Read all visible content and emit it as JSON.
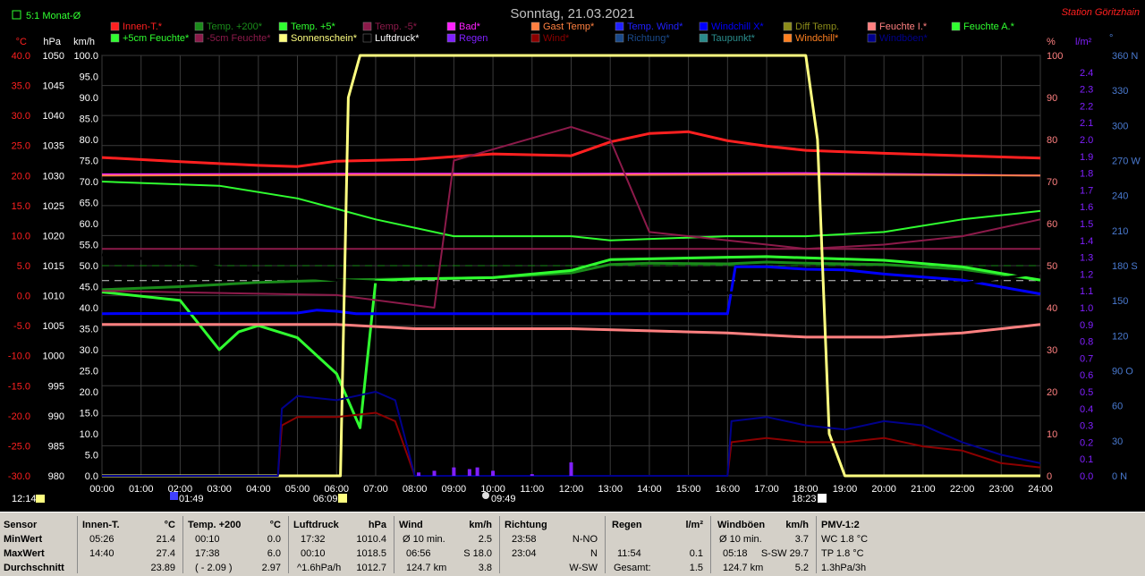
{
  "header": {
    "title": "Sonntag, 21.03.2021",
    "station": "Station Göritzhain",
    "period_label": "5:1 Monat-Ø"
  },
  "legend": [
    {
      "label": "Innen-T.*",
      "color": "#ff2020"
    },
    {
      "label": "Temp. +200*",
      "color": "#1a8c1a"
    },
    {
      "label": "Temp. +5*",
      "color": "#30ff30"
    },
    {
      "label": "Temp. -5*",
      "color": "#8c1a4a"
    },
    {
      "label": "Bad*",
      "color": "#ff20ff"
    },
    {
      "label": "Gast Temp*",
      "color": "#ff8040"
    },
    {
      "label": "Temp. Wind*",
      "color": "#2020ff"
    },
    {
      "label": "Windchill X*",
      "color": "#0000ff"
    },
    {
      "label": "Diff Temp.",
      "color": "#8c8c1a"
    },
    {
      "label": "Feuchte I.*",
      "color": "#ff8080"
    },
    {
      "label": "Feuchte A.*",
      "color": "#30ff30"
    },
    {
      "label": "+5cm Feuchte*",
      "color": "#30ff30"
    },
    {
      "label": "-5cm Feuchte*",
      "color": "#8c1a4a"
    },
    {
      "label": "Sonnenschein*",
      "color": "#ffff80"
    },
    {
      "label": "Luftdruck*",
      "color": "#000000"
    },
    {
      "label": "Regen",
      "color": "#8020ff"
    },
    {
      "label": "Wind*",
      "color": "#8c0000"
    },
    {
      "label": "Richtung*",
      "color": "#1a4a8c"
    },
    {
      "label": "Taupunkt*",
      "color": "#2a8c8c"
    },
    {
      "label": "Windchill*",
      "color": "#ff8020"
    },
    {
      "label": "Windböen*",
      "color": "#00008c"
    }
  ],
  "axes": {
    "celsius": {
      "unit": "°C",
      "ticks": [
        "40.0",
        "35.0",
        "30.0",
        "25.0",
        "20.0",
        "15.0",
        "10.0",
        "5.0",
        "0.0",
        "-5.0",
        "-10.0",
        "-15.0",
        "-20.0",
        "-25.0",
        "-30.0"
      ]
    },
    "hpa": {
      "unit": "hPa",
      "ticks": [
        "1050",
        "1045",
        "1040",
        "1035",
        "1030",
        "1025",
        "1020",
        "1015",
        "1010",
        "1005",
        "1000",
        "995",
        "990",
        "985",
        "980"
      ]
    },
    "kmh": {
      "unit": "km/h",
      "ticks": [
        "100.0",
        "95.0",
        "90.0",
        "85.0",
        "80.0",
        "75.0",
        "70.0",
        "65.0",
        "60.0",
        "55.0",
        "50.0",
        "45.0",
        "40.0",
        "35.0",
        "30.0",
        "25.0",
        "20.0",
        "15.0",
        "10.0",
        "5.0",
        "0.0"
      ]
    },
    "percent": {
      "unit": "%",
      "ticks": [
        "100",
        "90",
        "80",
        "70",
        "60",
        "50",
        "40",
        "30",
        "20",
        "10",
        "0"
      ]
    },
    "rain": {
      "unit": "l/m²",
      "ticks": [
        "2.4",
        "2.3",
        "2.2",
        "2.1",
        "2.0",
        "1.9",
        "1.8",
        "1.7",
        "1.6",
        "1.5",
        "1.4",
        "1.3",
        "1.2",
        "1.1",
        "1.0",
        "0.9",
        "0.8",
        "0.7",
        "0.6",
        "0.5",
        "0.4",
        "0.3",
        "0.2",
        "0.1",
        "0.0"
      ]
    },
    "direction": {
      "unit": "°",
      "ticks": [
        "360 N",
        "330",
        "300",
        "270 W",
        "240",
        "210",
        "180 S",
        "150",
        "120",
        "90 O",
        "60",
        "30",
        "0 N"
      ]
    },
    "time": {
      "ticks": [
        "00:00",
        "01:00",
        "02:00",
        "03:00",
        "04:00",
        "05:00",
        "06:00",
        "07:00",
        "08:00",
        "09:00",
        "10:00",
        "11:00",
        "12:00",
        "13:00",
        "14:00",
        "15:00",
        "16:00",
        "17:00",
        "18:00",
        "19:00",
        "20:00",
        "21:00",
        "22:00",
        "23:00",
        "24:00"
      ]
    }
  },
  "time_markers": {
    "now": "12:14",
    "moonrise": "01:49",
    "sunrise": "06:09",
    "moonset": "09:49",
    "sunset": "18:23"
  },
  "chart_data": {
    "type": "line",
    "title": "Sonntag, 21.03.2021",
    "x_unit": "hour of day",
    "xlim": [
      0,
      24
    ],
    "series": [
      {
        "name": "Innen-T.*",
        "axis": "°C",
        "color": "#ff2020",
        "x": [
          0,
          2,
          4,
          5,
          6,
          8,
          10,
          12,
          13,
          14,
          15,
          16,
          17,
          18,
          20,
          22,
          24
        ],
        "y": [
          23.0,
          22.3,
          21.7,
          21.5,
          22.4,
          22.7,
          23.6,
          23.3,
          25.6,
          27.0,
          27.3,
          25.8,
          24.9,
          24.2,
          23.7,
          23.3,
          22.9
        ]
      },
      {
        "name": "Temp. +200*",
        "axis": "°C",
        "color": "#1a8c1a",
        "x": [
          0,
          2,
          4,
          6,
          8,
          10,
          12,
          13,
          14,
          16,
          17,
          18,
          20,
          22,
          24
        ],
        "y": [
          1.0,
          1.5,
          2.2,
          2.6,
          2.8,
          3.0,
          3.8,
          5.2,
          5.4,
          5.3,
          5.6,
          5.4,
          5.2,
          4.4,
          2.6
        ]
      },
      {
        "name": "Temp. +5*",
        "axis": "°C",
        "color": "#30ff30",
        "x": [
          0,
          2,
          3,
          3.5,
          4,
          5,
          6,
          6.6,
          7,
          8,
          10,
          12,
          13,
          16,
          17,
          18,
          20,
          22,
          24
        ],
        "y": [
          0.6,
          -0.8,
          -9.0,
          -6.0,
          -5.0,
          -7.0,
          -13.0,
          -22.0,
          2.5,
          2.8,
          3.0,
          4.2,
          6.0,
          6.4,
          6.5,
          6.3,
          5.9,
          4.8,
          2.6
        ]
      },
      {
        "name": "Temp. -5*",
        "axis": "°C",
        "color": "#8c1a4a",
        "x": [
          0,
          6,
          12,
          18,
          24
        ],
        "y": [
          7.8,
          7.8,
          7.8,
          7.8,
          7.8
        ]
      },
      {
        "name": "Bad*",
        "axis": "°C",
        "color": "#ff20ff",
        "x": [
          0,
          6,
          12,
          18,
          24
        ],
        "y": [
          20.2,
          20.3,
          20.3,
          20.4,
          20.0
        ]
      },
      {
        "name": "Gast Temp*",
        "axis": "°C",
        "color": "#ff8040",
        "x": [
          0,
          6,
          12,
          18,
          24
        ],
        "y": [
          20.0,
          20.1,
          20.1,
          20.2,
          20.0
        ]
      },
      {
        "name": "Windchill X*",
        "axis": "°C",
        "color": "#0000ff",
        "x": [
          0,
          5,
          5.5,
          6,
          6.5,
          16,
          16.2,
          17,
          18,
          19,
          20,
          22,
          24
        ],
        "y": [
          -3.0,
          -2.9,
          -2.4,
          -2.6,
          -3.0,
          -3.0,
          4.8,
          4.8,
          4.4,
          4.3,
          3.6,
          2.6,
          0.3
        ]
      },
      {
        "name": "Luftdruck*",
        "axis": "hPa",
        "color": "#000000",
        "x": [
          0,
          2,
          4,
          6,
          8,
          10,
          12,
          14,
          16,
          18,
          20,
          22,
          24
        ],
        "y": [
          1016.8,
          1015.6,
          1013.8,
          1012.6,
          1012.0,
          1011.0,
          1010.9,
          1010.7,
          1010.5,
          1010.4,
          1011.0,
          1012.0,
          1013.8
        ]
      },
      {
        "name": "Feuchte I.*",
        "axis": "%",
        "color": "#ff8080",
        "x": [
          0,
          4,
          6,
          8,
          12,
          16,
          18,
          20,
          22,
          24
        ],
        "y": [
          36,
          36,
          36,
          35,
          35,
          34,
          33,
          33,
          34,
          36
        ]
      },
      {
        "name": "Feuchte A.*",
        "axis": "%",
        "color": "#30ff30",
        "x": [
          0,
          3,
          5,
          7,
          9,
          12,
          13,
          16,
          18,
          20,
          22,
          24
        ],
        "y": [
          70,
          69,
          66,
          61,
          57,
          57,
          56,
          57,
          57,
          58,
          61,
          63
        ]
      },
      {
        "name": "-5cm Feuchte*",
        "axis": "%",
        "color": "#8c1a4a",
        "x": [
          0,
          6,
          8.5,
          9,
          12,
          13,
          14,
          16,
          18,
          20,
          22,
          24
        ],
        "y": [
          44,
          43,
          40,
          75,
          83,
          80,
          58,
          56,
          54,
          55,
          57,
          61
        ]
      },
      {
        "name": "Sonnenschein*",
        "axis": "%",
        "color": "#ffff80",
        "x": [
          0,
          6.1,
          6.3,
          6.6,
          12,
          18,
          18.3,
          18.6,
          19,
          24
        ],
        "y": [
          0,
          0,
          90,
          100,
          100,
          100,
          80,
          10,
          0,
          0
        ]
      },
      {
        "name": "Wind*",
        "axis": "km/h",
        "color": "#8c0000",
        "x": [
          0,
          4.5,
          4.6,
          5,
          6,
          7,
          7.5,
          8,
          16,
          16.1,
          17,
          18,
          19,
          20,
          21,
          22,
          23,
          24
        ],
        "y": [
          0,
          0,
          12,
          14,
          14,
          15,
          13,
          0,
          0,
          8,
          9,
          8,
          8,
          9,
          7,
          6,
          3,
          2
        ]
      },
      {
        "name": "Windböen*",
        "axis": "km/h",
        "color": "#00008c",
        "x": [
          0,
          4.5,
          4.6,
          5,
          6,
          7,
          7.5,
          8,
          16,
          16.1,
          17,
          18,
          19,
          20,
          21,
          22,
          23,
          24
        ],
        "y": [
          0,
          0,
          16,
          19,
          18,
          20,
          18,
          0,
          0,
          13,
          14,
          12,
          11,
          13,
          12,
          8,
          5,
          3
        ]
      },
      {
        "name": "Regen",
        "axis": "l/m²",
        "color": "#8020ff",
        "x": [
          8.1,
          8.5,
          9.0,
          9.4,
          9.6,
          10,
          11,
          12.0
        ],
        "y": [
          0.02,
          0.03,
          0.05,
          0.04,
          0.05,
          0.03,
          0.01,
          0.08
        ]
      }
    ]
  },
  "footer": {
    "sensor": {
      "title": "Sensor",
      "rows": [
        "MinWert",
        "MaxWert",
        "Durchschnitt"
      ]
    },
    "innen": {
      "title": "Innen-T.",
      "unit": "°C",
      "rows": [
        [
          "05:26",
          "21.4"
        ],
        [
          "14:40",
          "27.4"
        ],
        [
          "",
          "23.89"
        ]
      ]
    },
    "temp200": {
      "title": "Temp. +200",
      "unit": "°C",
      "rows": [
        [
          "00:10",
          "0.0"
        ],
        [
          "17:38",
          "6.0"
        ],
        [
          "( - 2.09 )",
          "2.97"
        ]
      ]
    },
    "luftdruck": {
      "title": "Luftdruck",
      "unit": "hPa",
      "rows": [
        [
          "17:32",
          "1010.4"
        ],
        [
          "00:10",
          "1018.5"
        ],
        [
          "^1.6hPa/h",
          "1012.7"
        ]
      ]
    },
    "wind": {
      "title": "Wind",
      "unit": "km/h",
      "rows": [
        [
          "Ø 10 min.",
          "2.5"
        ],
        [
          "06:56",
          "S 18.0"
        ],
        [
          "124.7 km",
          "3.8"
        ]
      ]
    },
    "richtung": {
      "title": "Richtung",
      "rows": [
        [
          "23:58",
          "N-NO"
        ],
        [
          "23:04",
          "N"
        ],
        [
          "",
          "W-SW"
        ]
      ]
    },
    "regen": {
      "title": "Regen",
      "unit": "l/m²",
      "rows": [
        [
          "",
          ""
        ],
        [
          "11:54",
          "0.1"
        ],
        [
          "Gesamt:",
          "1.5"
        ]
      ]
    },
    "windboeen": {
      "title": "Windböen",
      "unit": "km/h",
      "rows": [
        [
          "Ø 10 min.",
          "3.7"
        ],
        [
          "05:18",
          "S-SW 29.7"
        ],
        [
          "124.7 km",
          "5.2"
        ]
      ]
    },
    "pmv": {
      "title": "PMV-1:2",
      "rows": [
        "WC 1.8 °C",
        "TP 1.8 °C",
        "1.3hPa/3h"
      ]
    }
  }
}
